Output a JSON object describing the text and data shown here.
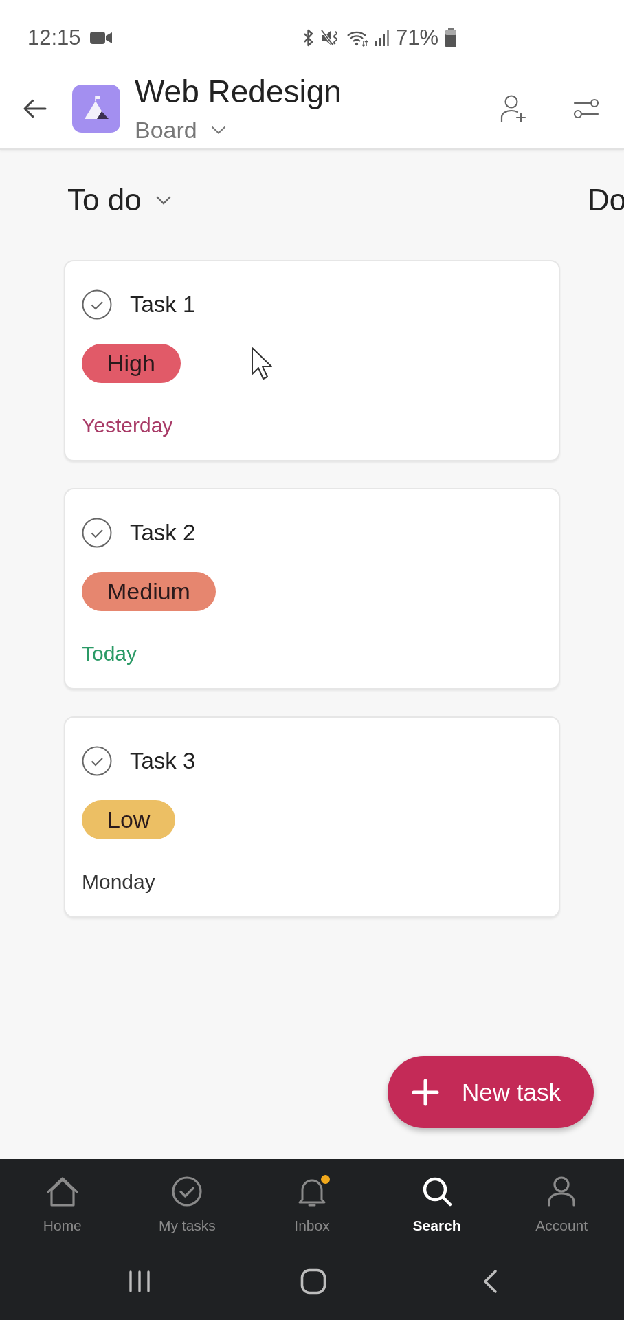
{
  "status_bar": {
    "time": "12:15",
    "battery": "71%"
  },
  "header": {
    "title": "Web Redesign",
    "view": "Board"
  },
  "columns": [
    {
      "title": "To do",
      "cards": [
        {
          "title": "Task 1",
          "completed": false,
          "priority": {
            "label": "High",
            "color": "#e15a68"
          },
          "due": {
            "label": "Yesterday",
            "color": "#a83a66"
          }
        },
        {
          "title": "Task 2",
          "completed": false,
          "priority": {
            "label": "Medium",
            "color": "#e6866f"
          },
          "due": {
            "label": "Today",
            "color": "#2b9a66"
          }
        },
        {
          "title": "Task 3",
          "completed": false,
          "priority": {
            "label": "Low",
            "color": "#ecbf64"
          },
          "due": {
            "label": "Monday",
            "color": "#333333"
          }
        }
      ]
    },
    {
      "title": "Do"
    }
  ],
  "fab": {
    "label": "New task"
  },
  "nav": {
    "items": [
      {
        "label": "Home",
        "selected": false,
        "unread": false
      },
      {
        "label": "My tasks",
        "selected": false,
        "unread": false
      },
      {
        "label": "Inbox",
        "selected": false,
        "unread": true
      },
      {
        "label": "Search",
        "selected": true,
        "unread": false
      },
      {
        "label": "Account",
        "selected": false,
        "unread": false
      }
    ]
  }
}
